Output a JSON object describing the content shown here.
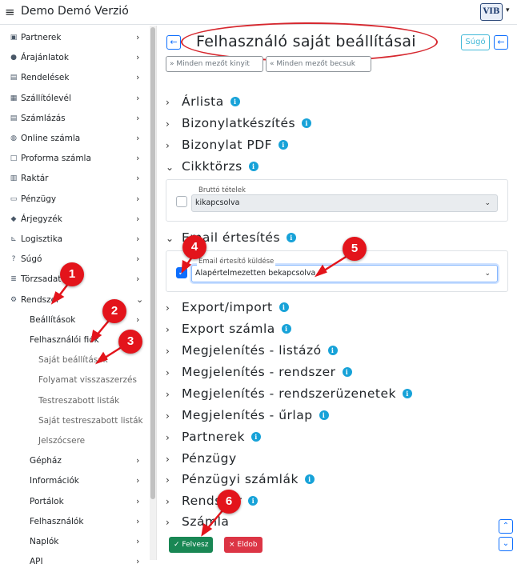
{
  "header": {
    "menu_icon": "hamburger-icon",
    "app_title": "Demo Demó Verzió",
    "logo_text": "VIB",
    "logo_caret": "▾"
  },
  "sidebar": {
    "items": [
      {
        "label": "Partnerek",
        "icon": "id-card-icon",
        "chev": "›"
      },
      {
        "label": "Árajánlatok",
        "icon": "users-icon",
        "chev": "›"
      },
      {
        "label": "Rendelések",
        "icon": "file-icon",
        "chev": "›"
      },
      {
        "label": "Szállítólevél",
        "icon": "clipboard-icon",
        "chev": "›"
      },
      {
        "label": "Számlázás",
        "icon": "invoice-icon",
        "chev": "›"
      },
      {
        "label": "Online számla",
        "icon": "globe-icon",
        "chev": "›"
      },
      {
        "label": "Proforma számla",
        "icon": "square-icon",
        "chev": "›"
      },
      {
        "label": "Raktár",
        "icon": "warehouse-icon",
        "chev": "›"
      },
      {
        "label": "Pénzügy",
        "icon": "money-icon",
        "chev": "›"
      },
      {
        "label": "Árjegyzék",
        "icon": "tags-icon",
        "chev": "›"
      },
      {
        "label": "Logisztika",
        "icon": "dolly-icon",
        "chev": "›"
      },
      {
        "label": "Súgó",
        "icon": "question-icon",
        "chev": "›"
      },
      {
        "label": "Törzsadatok",
        "icon": "database-icon",
        "chev": "›"
      },
      {
        "label": "Rendszer",
        "icon": "cogs-icon",
        "chev": "⌄"
      }
    ],
    "sub_items": [
      {
        "label": "Beállítások",
        "chev": "›"
      },
      {
        "label": "Felhasználói fiók",
        "chev": "⌄"
      }
    ],
    "sub2_items": [
      {
        "label": "Saját beállítások"
      },
      {
        "label": "Folyamat visszaszerzés"
      },
      {
        "label": "Testreszabott listák"
      },
      {
        "label": "Saját testreszabott listák"
      },
      {
        "label": "Jelszócsere"
      }
    ],
    "sub_items_after": [
      {
        "label": "Gépház",
        "chev": "›"
      },
      {
        "label": "Információk",
        "chev": "›"
      },
      {
        "label": "Portálok",
        "chev": "›"
      },
      {
        "label": "Felhasználók",
        "chev": "›"
      },
      {
        "label": "Naplók",
        "chev": "›"
      },
      {
        "label": "API",
        "chev": "›"
      }
    ]
  },
  "main": {
    "back_icon": "←",
    "title": "Felhasználó saját beállításai",
    "help_label": "Súgó",
    "expand_all_label": "Minden mezőt kinyit",
    "collapse_all_label": "Minden mezőt becsuk",
    "info_glyph": "i",
    "sections": [
      {
        "label": "Árlista",
        "arrow": "›",
        "info": true
      },
      {
        "label": "Bizonylatkészítés",
        "arrow": "›",
        "info": true
      },
      {
        "label": "Bizonylat PDF",
        "arrow": "›",
        "info": true
      },
      {
        "label": "Cikktörzs",
        "arrow": "⌄",
        "info": true
      },
      {
        "label": "Email értesítés",
        "arrow": "⌄",
        "info": true
      },
      {
        "label": "Export/import",
        "arrow": "›",
        "info": true
      },
      {
        "label": "Export számla",
        "arrow": "›",
        "info": true
      },
      {
        "label": "Megjelenítés - listázó",
        "arrow": "›",
        "info": true
      },
      {
        "label": "Megjelenítés - rendszer",
        "arrow": "›",
        "info": true
      },
      {
        "label": "Megjelenítés - rendszerüzenetek",
        "arrow": "›",
        "info": true
      },
      {
        "label": "Megjelenítés - űrlap",
        "arrow": "›",
        "info": true
      },
      {
        "label": "Partnerek",
        "arrow": "›",
        "info": true
      },
      {
        "label": "Pénzügy",
        "arrow": "›",
        "info": false
      },
      {
        "label": "Pénzügyi számlák",
        "arrow": "›",
        "info": true
      },
      {
        "label": "Rendszer",
        "arrow": "›",
        "info": true
      },
      {
        "label": "Számla",
        "arrow": "›",
        "info": false
      }
    ],
    "cikktorzs_field": {
      "label": "Bruttó tételek",
      "value": "kikapcsolva",
      "checked": false
    },
    "email_field": {
      "label": "Email értesítő küldése",
      "value": "Alapértelmezetten bekapcsolva",
      "checked": true
    },
    "save_label": "Felvesz",
    "save_icon": "✓",
    "discard_label": "Eldob",
    "discard_icon": "×",
    "scroll_up": "⌃",
    "scroll_down": "⌄"
  },
  "annotations": {
    "badges": [
      "1",
      "2",
      "3",
      "4",
      "5",
      "6"
    ],
    "color": "#e3141b"
  }
}
